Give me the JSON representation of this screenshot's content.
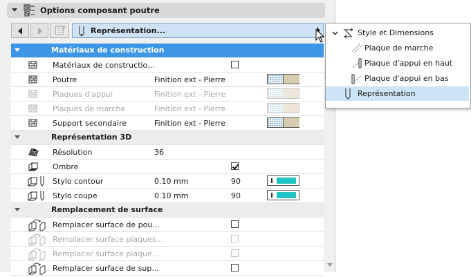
{
  "panel": {
    "title": "Options composant poutre",
    "nav": {
      "combo_label": "Représentation..."
    }
  },
  "sections": [
    {
      "label": "Matériaux de construction",
      "selected": true,
      "rows": [
        {
          "name": "Matériaux de constructio...",
          "icon": "material-icon",
          "control": "checkbox",
          "checked": false,
          "disabled": false
        },
        {
          "name": "Poutre",
          "icon": "material-icon",
          "value": "Finition ext - Pierre",
          "control": "swatch",
          "disabled": false
        },
        {
          "name": "Plaques d'appui",
          "icon": "material-icon",
          "value": "Finition ext - Pierre",
          "control": "swatch",
          "disabled": true
        },
        {
          "name": "Plaques de marche",
          "icon": "material-icon",
          "value": "Finition ext - Pierre",
          "control": "swatch",
          "disabled": true
        },
        {
          "name": "Support secondaire",
          "icon": "material-icon",
          "value": "Finition ext - Pierre",
          "control": "swatch",
          "disabled": false
        }
      ]
    },
    {
      "label": "Représentation 3D",
      "selected": false,
      "rows": [
        {
          "name": "Résolution",
          "icon": "resolution-icon",
          "value": "36",
          "disabled": false
        },
        {
          "name": "Ombre",
          "icon": "shadow-icon",
          "control": "checkbox",
          "checked": true,
          "disabled": false
        },
        {
          "name": "Stylo contour",
          "icon": "pen-contour-icon",
          "value": "0.10 mm",
          "num": "90",
          "control": "pen",
          "disabled": false
        },
        {
          "name": "Stylo coupe",
          "icon": "pen-cut-icon",
          "value": "0.10 mm",
          "num": "90",
          "control": "pen",
          "disabled": false
        }
      ]
    },
    {
      "label": "Remplacement de surface",
      "selected": false,
      "rows": [
        {
          "name": "Remplacer surface de pou...",
          "icon": "surface-override-icon",
          "control": "checkbox",
          "checked": false,
          "disabled": false
        },
        {
          "name": "Remplacer surface plaques...",
          "icon": "surface-override-icon",
          "control": "checkbox",
          "checked": false,
          "disabled": true
        },
        {
          "name": "Remplacer surface plaque...",
          "icon": "surface-override-icon",
          "control": "checkbox",
          "checked": false,
          "disabled": true
        },
        {
          "name": "Remplacer surface de sup...",
          "icon": "surface-override-icon",
          "control": "checkbox",
          "checked": false,
          "disabled": false
        }
      ]
    }
  ],
  "popup": {
    "group_label": "Style et Dimensions",
    "items": [
      {
        "label": "Plaque de marche",
        "icon": "tread-plate-icon",
        "selected": false
      },
      {
        "label": "Plaque d'appui en haut",
        "icon": "top-bearing-plate-icon",
        "selected": false
      },
      {
        "label": "Plaque d'appui en bas",
        "icon": "bottom-bearing-plate-icon",
        "selected": false
      },
      {
        "label": "Représentation",
        "icon": "representation-icon",
        "selected": true
      }
    ]
  },
  "colors": {
    "section_selected": "#3e97e6",
    "combo_bg": "#cfe2f4",
    "popup_selected": "#cce4f7",
    "material_tan": "#d8ccb0",
    "pen_fill": "#1fc4c4"
  }
}
